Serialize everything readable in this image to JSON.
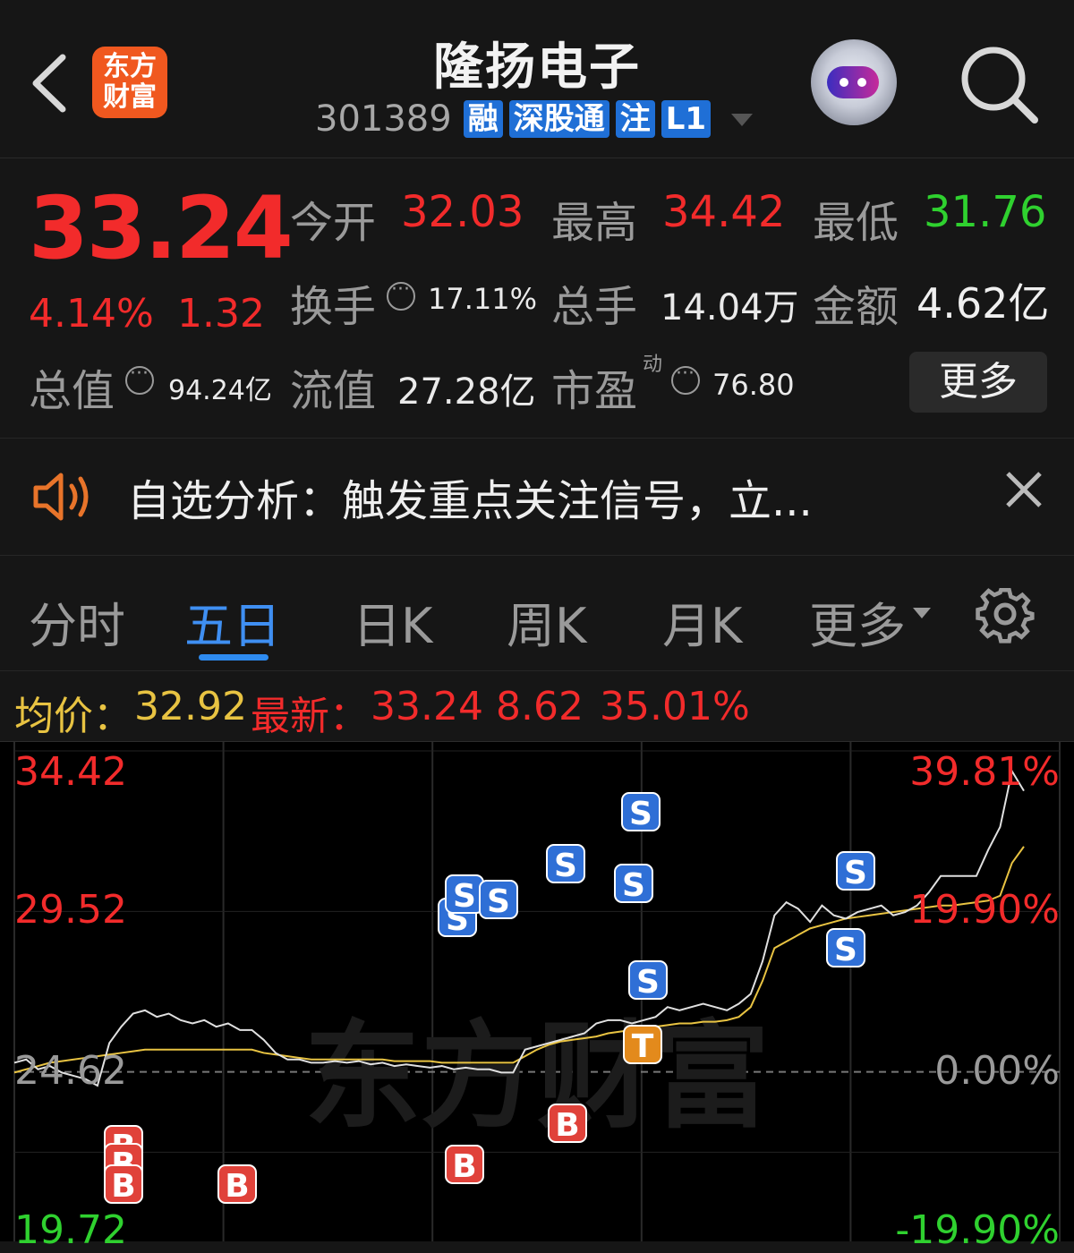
{
  "header": {
    "back_icon": "chevron-left-icon",
    "logo_lines": [
      "东方",
      "财富"
    ],
    "title": "隆扬电子",
    "code": "301389",
    "tags": [
      "融",
      "深股通",
      "注",
      "L1"
    ],
    "search_icon": "search-icon"
  },
  "quote": {
    "price": "33.24",
    "change_pct": "4.14%",
    "change_amt": "1.32",
    "open_label": "今开",
    "open": "32.03",
    "high_label": "最高",
    "high": "34.42",
    "low_label": "最低",
    "low": "31.76",
    "turnover_label": "换手",
    "turnover": "17.11%",
    "volume_label": "总手",
    "volume": "14.04万",
    "amount_label": "金额",
    "amount": "4.62亿",
    "mktcap_label": "总值",
    "mktcap": "94.24亿",
    "float_label": "流值",
    "float": "27.28亿",
    "pe_label": "市盈",
    "pe_sup": "动",
    "pe": "76.80",
    "more_label": "更多"
  },
  "notice": {
    "text": "自选分析：触发重点关注信号，立...",
    "speaker_icon": "speaker-icon",
    "close_icon": "close-icon"
  },
  "tabs": {
    "items": [
      "分时",
      "五日",
      "日K",
      "周K",
      "月K",
      "更多"
    ],
    "active": "五日",
    "settings_icon": "gear-icon"
  },
  "info_bar": {
    "avg_label": "均价：",
    "avg": "32.92",
    "latest_label": "最新：",
    "latest": "33.24",
    "change": "8.62",
    "change_pct": "35.01%"
  },
  "chart_data": {
    "type": "line",
    "y_left_labels": [
      "34.42",
      "29.52",
      "24.62",
      "19.72"
    ],
    "y_right_labels": [
      "39.81%",
      "19.90%",
      "0.00%",
      "-19.90%"
    ],
    "ylim": [
      19.72,
      34.42
    ],
    "baseline": 24.62,
    "days": 5,
    "watermark": "东方财富",
    "colors": {
      "price": "#e0e0e0",
      "avg": "#e8c342",
      "buy": "#e0423a",
      "sell": "#2f6fd6",
      "t": "#e38a1c"
    },
    "series": [
      {
        "values": [
          24.9,
          25.0,
          24.7,
          24.8,
          24.6,
          24.5,
          24.4,
          24.2,
          25.5,
          26.0,
          26.4,
          26.5,
          26.3,
          26.4,
          26.2,
          26.1,
          26.2,
          26.0,
          26.1,
          25.9,
          25.9,
          25.6,
          25.2,
          25.0,
          25.0,
          24.9,
          24.9,
          24.95,
          24.9,
          24.95,
          24.85,
          24.9,
          24.8,
          24.85,
          24.8,
          24.75,
          24.8,
          24.7,
          24.75,
          24.7,
          24.7,
          24.6,
          24.6,
          25.3,
          25.4,
          25.5,
          25.6,
          25.7,
          25.8,
          26.1,
          26.2,
          26.2,
          26.1,
          26.2,
          26.3,
          26.6,
          26.5,
          26.6,
          26.7,
          26.6,
          26.5,
          26.7,
          27.0,
          28.0,
          29.4,
          29.8,
          29.6,
          29.2,
          29.7,
          29.4,
          29.3,
          29.5,
          29.6,
          29.7,
          29.4,
          29.5,
          29.7,
          30.1,
          30.6,
          30.6,
          30.6,
          30.6,
          31.4,
          32.1,
          33.8,
          33.2
        ],
        "name": ""
      },
      {
        "values": [
          24.6,
          24.7,
          24.8,
          24.9,
          24.95,
          25.0,
          25.05,
          25.1,
          25.15,
          25.2,
          25.25,
          25.3,
          25.3,
          25.3,
          25.3,
          25.3,
          25.3,
          25.3,
          25.3,
          25.3,
          25.3,
          25.2,
          25.15,
          25.1,
          25.05,
          25.0,
          25.0,
          25.0,
          25.0,
          25.0,
          25.0,
          25.0,
          24.95,
          24.95,
          24.95,
          24.95,
          24.9,
          24.9,
          24.9,
          24.9,
          24.9,
          24.9,
          24.9,
          25.1,
          25.3,
          25.45,
          25.55,
          25.6,
          25.65,
          25.7,
          25.8,
          25.85,
          25.9,
          25.95,
          26.0,
          26.05,
          26.1,
          26.1,
          26.15,
          26.15,
          26.2,
          26.3,
          26.6,
          27.4,
          28.4,
          28.6,
          28.8,
          29.0,
          29.1,
          29.2,
          29.3,
          29.35,
          29.4,
          29.45,
          29.5,
          29.55,
          29.6,
          29.65,
          29.7,
          29.7,
          29.75,
          29.8,
          29.85,
          30.0,
          31.0,
          31.5
        ],
        "name": ""
      }
    ],
    "markers": [
      "B",
      "B",
      "B",
      "B",
      "B",
      "B",
      "S",
      "S",
      "S",
      "S",
      "S",
      "S",
      "S",
      "S",
      "S",
      "T"
    ]
  }
}
